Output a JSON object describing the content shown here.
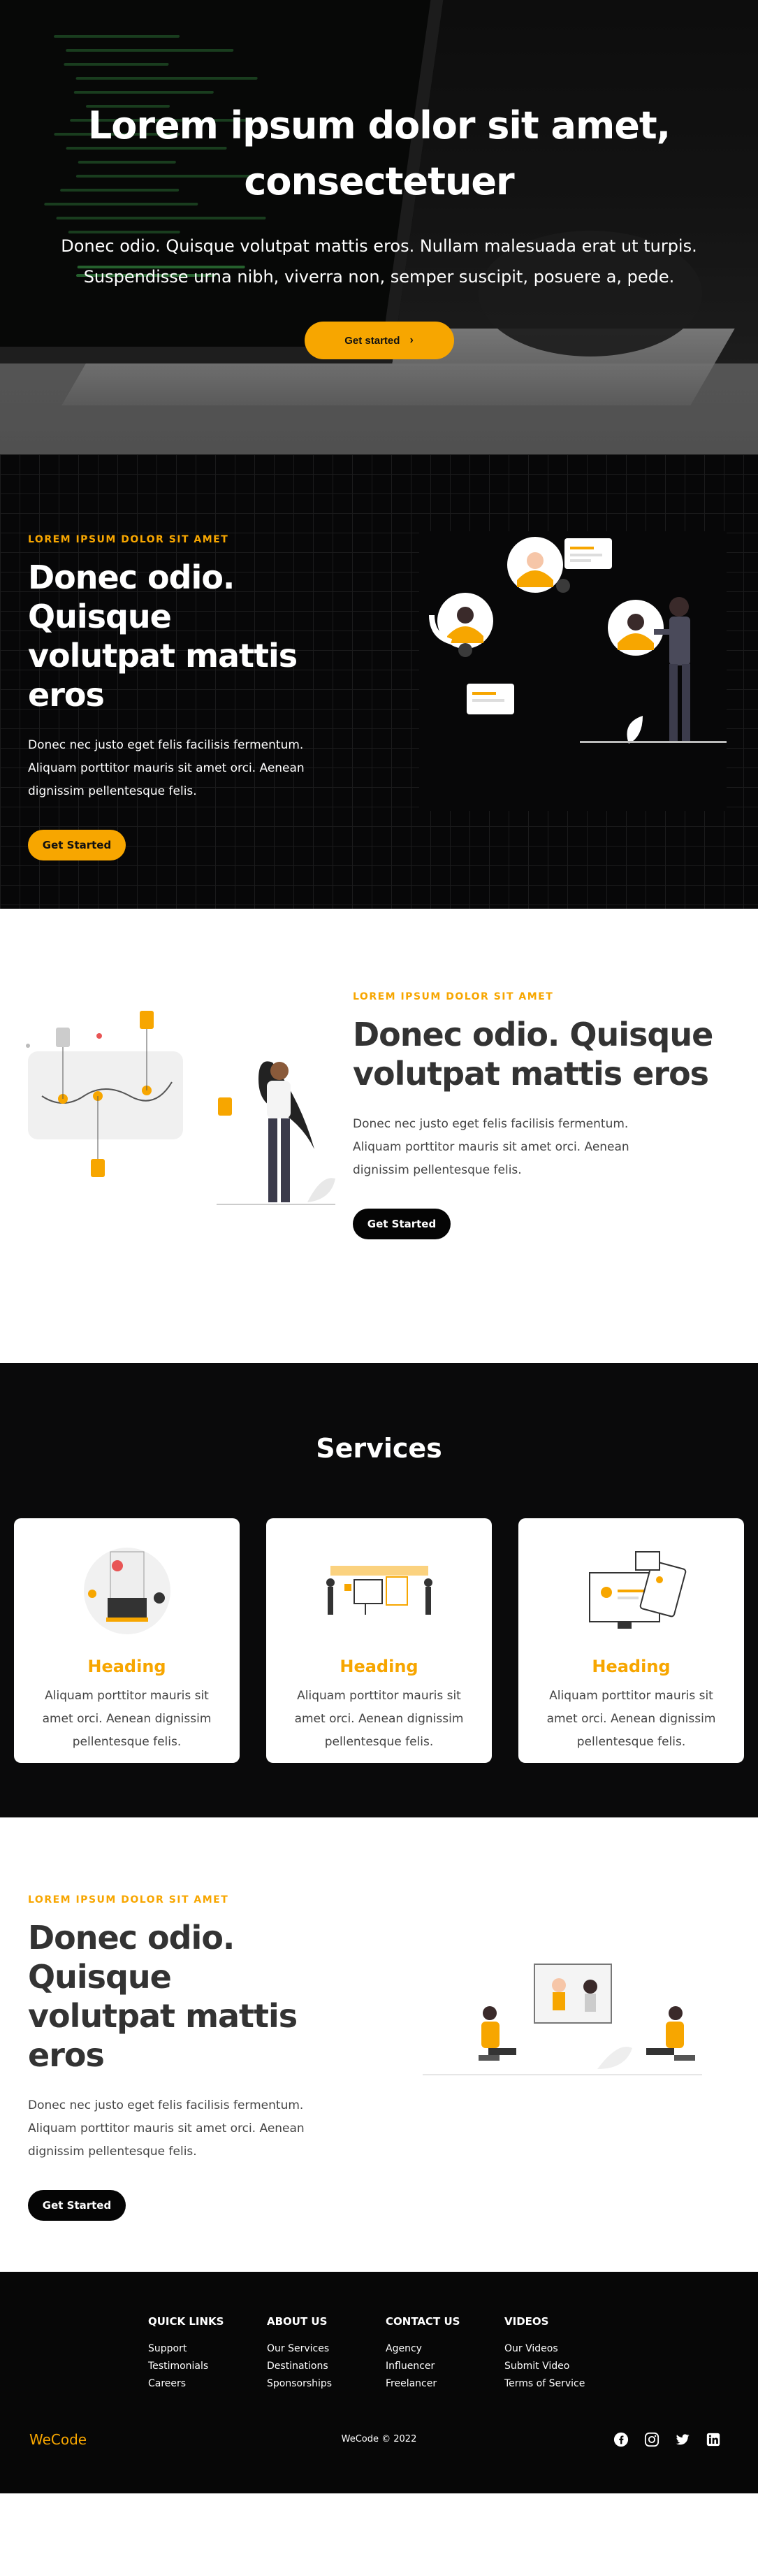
{
  "hero": {
    "title_line1": "Lorem ipsum dolor sit amet,",
    "title_line2": "consectetuer",
    "text_line1": "Donec odio. Quisque volutpat mattis eros. Nullam malesuada erat ut turpis.",
    "text_line2": "Suspendisse urna nibh, viverra non, semper suscipit, posuere a, pede.",
    "button_label": "Get started",
    "button_icon": "chevron-right-icon"
  },
  "section_one": {
    "eyebrow": "LOREM IPSUM DOLOR SIT AMET",
    "title_line1": "Donec odio. Quisque",
    "title_line2": "volutpat mattis eros",
    "text_line1": "Donec nec justo eget felis facilisis fermentum.",
    "text_line2": "Aliquam porttitor mauris sit amet orci. Aenean",
    "text_line3": "dignissim pellentesque felis.",
    "button_label": "Get Started"
  },
  "section_two": {
    "eyebrow": "LOREM IPSUM DOLOR SIT AMET",
    "title_line1": "Donec odio. Quisque",
    "title_line2": "volutpat mattis eros",
    "text_line1": "Donec nec justo eget felis facilisis fermentum.",
    "text_line2": "Aliquam porttitor mauris sit amet orci. Aenean",
    "text_line3": "dignissim pellentesque felis.",
    "button_label": "Get Started"
  },
  "services": {
    "title": "Services",
    "cards": [
      {
        "heading": "Heading",
        "line1": "Aliquam porttitor mauris sit",
        "line2": "amet orci. Aenean dignissim",
        "line3": "pellentesque felis."
      },
      {
        "heading": "Heading",
        "line1": "Aliquam porttitor mauris sit",
        "line2": "amet orci. Aenean dignissim",
        "line3": "pellentesque felis."
      },
      {
        "heading": "Heading",
        "line1": "Aliquam porttitor mauris sit",
        "line2": "amet orci. Aenean dignissim",
        "line3": "pellentesque felis."
      }
    ]
  },
  "section_three": {
    "eyebrow": "LOREM IPSUM DOLOR SIT AMET",
    "title_line1": "Donec odio. Quisque",
    "title_line2": "volutpat mattis eros",
    "text_line1": "Donec nec justo eget felis facilisis fermentum.",
    "text_line2": "Aliquam porttitor mauris sit amet orci. Aenean",
    "text_line3": "dignissim pellentesque felis.",
    "button_label": "Get Started"
  },
  "footer": {
    "brand": "WeCode",
    "copyright": "WeCode © 2022",
    "columns": [
      {
        "title": "QUICK LINKS",
        "links": [
          "Support",
          "Testimonials",
          "Careers"
        ]
      },
      {
        "title": "ABOUT US",
        "links": [
          "Our Services",
          "Destinations",
          "Sponsorships"
        ]
      },
      {
        "title": "CONTACT US",
        "links": [
          "Agency",
          "Influencer",
          "Freelancer"
        ]
      },
      {
        "title": "VIDEOS",
        "links": [
          "Our Videos",
          "Submit Video",
          "Terms of Service"
        ]
      }
    ],
    "socials": [
      "facebook-icon",
      "instagram-icon",
      "twitter-icon",
      "linkedin-icon"
    ]
  },
  "colors": {
    "accent": "#f7a600",
    "dark_bg": "#070708",
    "text_dark": "#333333"
  }
}
